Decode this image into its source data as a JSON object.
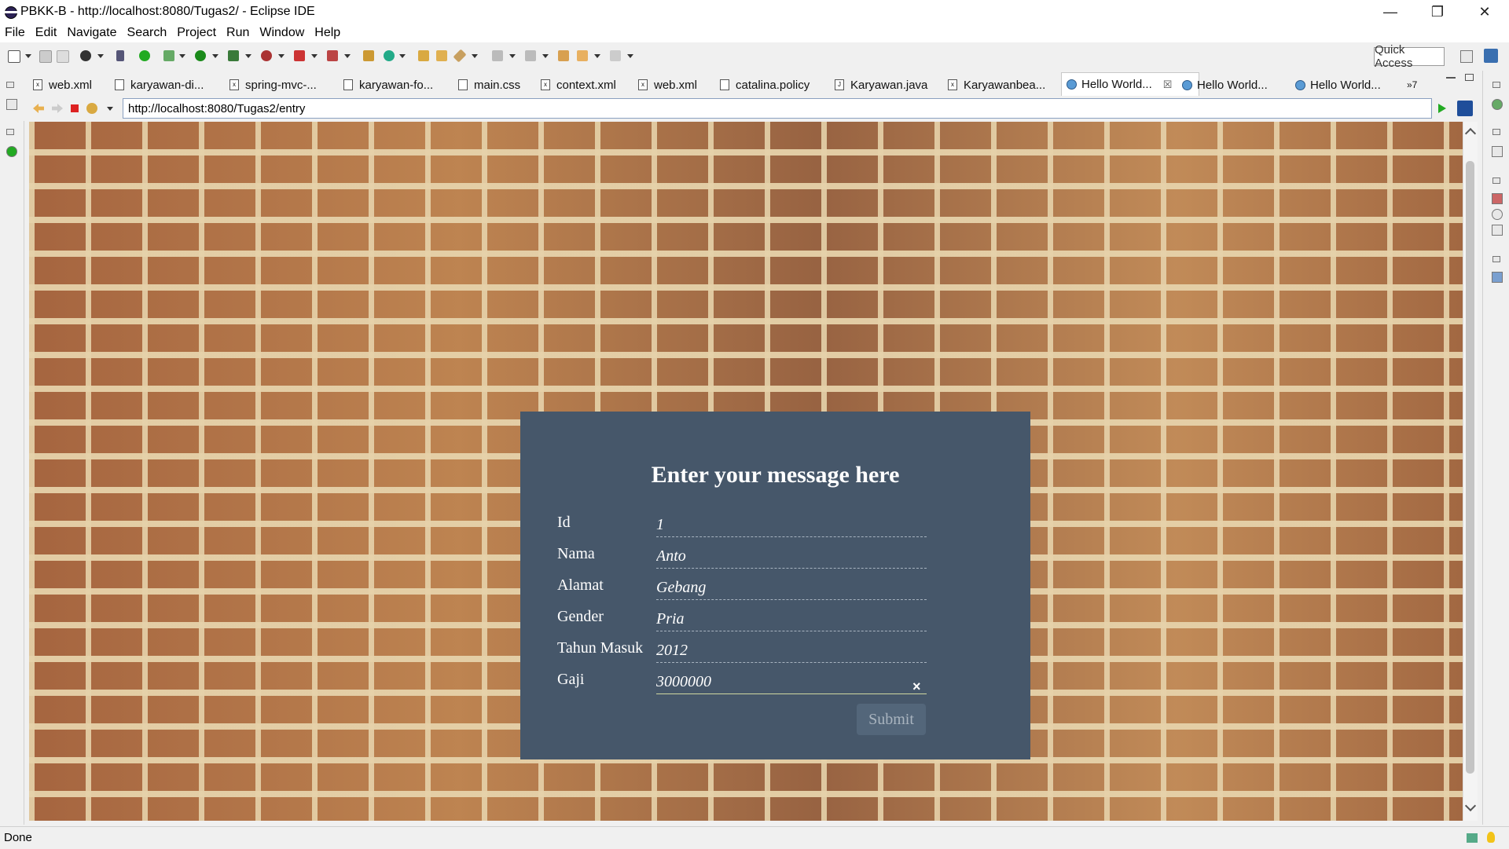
{
  "window": {
    "title": "PBKK-B - http://localhost:8080/Tugas2/ - Eclipse IDE",
    "minimize_glyph": "—",
    "restore_glyph": "❐",
    "close_glyph": "✕"
  },
  "menu": [
    "File",
    "Edit",
    "Navigate",
    "Search",
    "Project",
    "Run",
    "Window",
    "Help"
  ],
  "quick_access": "Quick Access",
  "tabs": [
    {
      "label": "web.xml",
      "icon": "x"
    },
    {
      "label": "karyawan-di...",
      "icon": "doc"
    },
    {
      "label": "spring-mvc-...",
      "icon": "x"
    },
    {
      "label": "karyawan-fo...",
      "icon": "doc"
    },
    {
      "label": "main.css",
      "icon": "doc"
    },
    {
      "label": "context.xml",
      "icon": "x"
    },
    {
      "label": "web.xml",
      "icon": "x"
    },
    {
      "label": "catalina.policy",
      "icon": "doc"
    },
    {
      "label": "Karyawan.java",
      "icon": "J"
    },
    {
      "label": "Karyawanbea...",
      "icon": "x"
    },
    {
      "label": "Hello World...",
      "icon": "globe",
      "active": true
    },
    {
      "label": "Hello World...",
      "icon": "globe"
    },
    {
      "label": "Hello World...",
      "icon": "globe"
    }
  ],
  "tab_overflow": "»7",
  "browser": {
    "url": "http://localhost:8080/Tugas2/entry"
  },
  "form": {
    "heading": "Enter your message here",
    "fields": [
      {
        "label": "Id",
        "value": "1"
      },
      {
        "label": "Nama",
        "value": "Anto"
      },
      {
        "label": "Alamat",
        "value": "Gebang"
      },
      {
        "label": "Gender",
        "value": "Pria"
      },
      {
        "label": "Tahun Masuk",
        "value": "2012"
      },
      {
        "label": "Gaji",
        "value": "3000000"
      }
    ],
    "clear_glyph": "×",
    "submit_label": "Submit"
  },
  "status": {
    "text": "Done"
  },
  "colors": {
    "panel_bg": "#46576a",
    "brick_mortar": "#e6d2aa",
    "brick": "#b88a5c"
  }
}
